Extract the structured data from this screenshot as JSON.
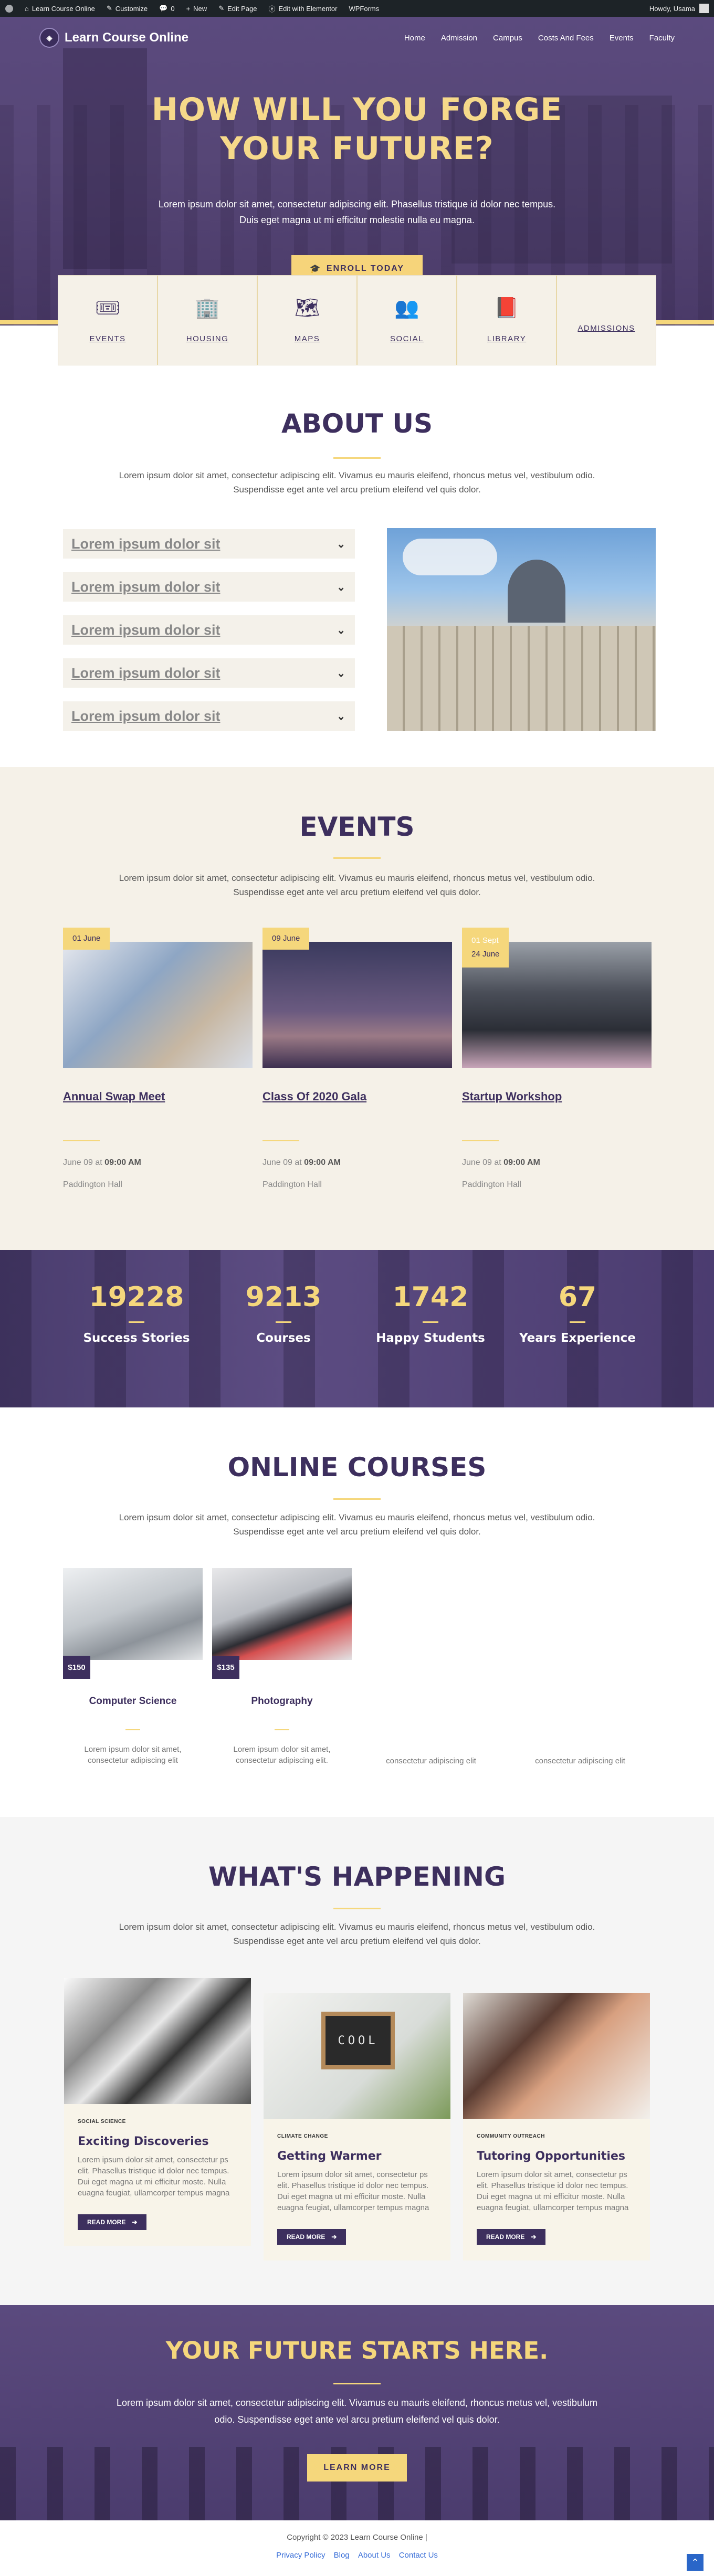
{
  "adminbar": {
    "site": "Learn Course Online",
    "customize": "Customize",
    "comments": "0",
    "new": "New",
    "edit_page": "Edit Page",
    "elementor": "Edit with Elementor",
    "wpforms": "WPForms",
    "howdy": "Howdy, Usama"
  },
  "header": {
    "logo": "Learn Course Online",
    "nav": [
      "Home",
      "Admission",
      "Campus",
      "Costs And Fees",
      "Events",
      "Faculty"
    ]
  },
  "hero": {
    "title_line1": "HOW WILL YOU FORGE",
    "title_line2": "YOUR FUTURE?",
    "text": "Lorem ipsum dolor sit amet, consectetur adipiscing elit. Phasellus tristique id dolor nec tempus. Duis eget magna ut mi efficitur molestie nulla eu magna.",
    "button": "ENROLL TODAY"
  },
  "quicklinks": [
    {
      "label": "EVENTS",
      "icon": "ticket-icon"
    },
    {
      "label": "HOUSING",
      "icon": "building-icon"
    },
    {
      "label": "MAPS",
      "icon": "map-icon"
    },
    {
      "label": "SOCIAL",
      "icon": "users-icon"
    },
    {
      "label": "LIBRARY",
      "icon": "book-icon"
    },
    {
      "label": "ADMISSIONS",
      "icon": "admissions-icon"
    }
  ],
  "about": {
    "title": "ABOUT US",
    "text": "Lorem ipsum dolor sit amet, consectetur adipiscing elit. Vivamus eu mauris eleifend, rhoncus metus vel, vestibulum odio. Suspendisse eget ante vel arcu pretium eleifend vel quis dolor.",
    "accordion": [
      "Lorem ipsum dolor sit",
      "Lorem ipsum dolor sit",
      "Lorem ipsum dolor sit",
      "Lorem ipsum dolor sit",
      "Lorem ipsum dolor sit"
    ]
  },
  "events": {
    "title": "EVENTS",
    "text": "Lorem ipsum dolor sit amet, consectetur adipiscing elit. Vivamus eu mauris eleifend, rhoncus metus vel, vestibulum odio. Suspendisse eget ante vel arcu pretium eleifend vel quis dolor.",
    "items": [
      {
        "date": "01 June",
        "title": "Annual Swap Meet",
        "time_prefix": "June 09 at ",
        "time": "09:00 AM",
        "place": "Paddington Hall"
      },
      {
        "date": "09 June",
        "title": "Class Of 2020 Gala",
        "time_prefix": "June 09 at ",
        "time": "09:00 AM",
        "place": "Paddington Hall"
      },
      {
        "date_top": "01 Sept",
        "date": "24 June",
        "title": "Startup Workshop",
        "time_prefix": "June 09 at ",
        "time": "09:00 AM",
        "place": "Paddington Hall"
      }
    ]
  },
  "stats": [
    {
      "num": "19228",
      "label": "Success Stories"
    },
    {
      "num": "9213",
      "label": "Courses"
    },
    {
      "num": "1742",
      "label": "Happy Students"
    },
    {
      "num": "67",
      "label": "Years Experience"
    }
  ],
  "courses": {
    "title": "ONLINE COURSES",
    "text": "Lorem ipsum dolor sit amet, consectetur adipiscing elit. Vivamus eu mauris eleifend, rhoncus metus vel, vestibulum odio. Suspendisse eget ante vel arcu pretium eleifend vel quis dolor.",
    "items": [
      {
        "price": "$150",
        "title": "Computer Science",
        "text": "Lorem ipsum dolor sit amet, consectetur adipiscing elit"
      },
      {
        "price": "$135",
        "title": "Photography",
        "text": "Lorem ipsum dolor sit amet, consectetur adipiscing elit."
      },
      {
        "text": "consectetur adipiscing elit"
      },
      {
        "text": "consectetur adipiscing elit"
      }
    ]
  },
  "happening": {
    "title": "WHAT'S HAPPENING",
    "text": "Lorem ipsum dolor sit amet, consectetur adipiscing elit. Vivamus eu mauris eleifend, rhoncus metus vel, vestibulum odio. Suspendisse eget ante vel arcu pretium eleifend vel quis dolor.",
    "items": [
      {
        "cat": "SOCIAL SCIENCE",
        "title": "Exciting Discoveries",
        "text": "Lorem ipsum dolor sit amet, consectetur ps elit. Phasellus tristique id dolor nec tempus. Dui eget magna ut mi efficitur moste. Nulla euagna feugiat, ullamcorper tempus magna",
        "button": "READ MORE"
      },
      {
        "cat": "CLIMATE CHANGE",
        "title": "Getting Warmer",
        "text": "Lorem ipsum dolor sit amet, consectetur ps elit. Phasellus tristique id dolor nec tempus. Dui eget magna ut mi efficitur moste. Nulla euagna feugiat, ullamcorper tempus magna",
        "button": "READ MORE",
        "sign": "COOL"
      },
      {
        "cat": "COMMUNITY OUTREACH",
        "title": "Tutoring Opportunities",
        "text": "Lorem ipsum dolor sit amet, consectetur ps elit. Phasellus tristique id dolor nec tempus. Dui eget magna ut mi efficitur moste. Nulla euagna feugiat, ullamcorper tempus magna",
        "button": "READ MORE"
      }
    ]
  },
  "cta": {
    "title": "YOUR FUTURE STARTS HERE.",
    "text": "Lorem ipsum dolor sit amet, consectetur adipiscing elit. Vivamus eu mauris eleifend, rhoncus metus vel, vestibulum odio. Suspendisse eget ante vel arcu pretium eleifend vel quis dolor.",
    "button": "LEARN MORE"
  },
  "footer": {
    "copy": "Copyright © 2023 Learn Course Online |",
    "links": [
      "Privacy Policy",
      "Blog",
      "About Us",
      "Contact Us"
    ]
  },
  "colors": {
    "primary": "#3d2f5e",
    "accent": "#f5d77c",
    "cream": "#f5f1e8"
  }
}
